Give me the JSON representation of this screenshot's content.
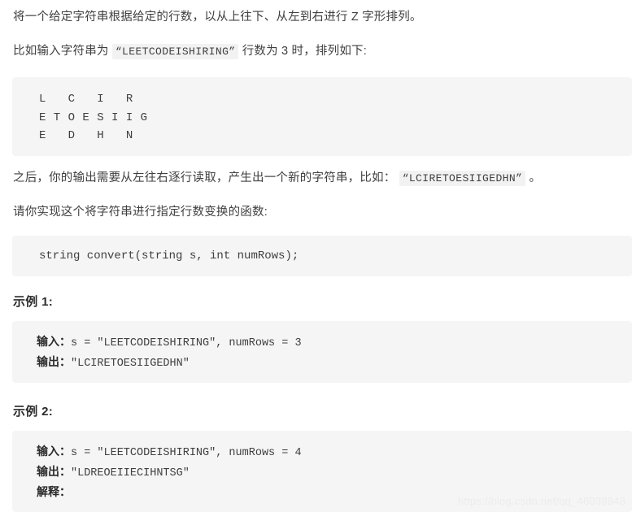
{
  "document": {
    "paragraphs": {
      "intro": "将一个给定字符串根据给定的行数，以从上往下、从左到右进行 Z 字形排列。",
      "example_lead_before": "比如输入字符串为",
      "example_lead_code": "“LEETCODEISHIRING”",
      "example_lead_after": "行数为 3 时，排列如下:",
      "read_lead_before": "之后，你的输出需要从左往右逐行读取，产生出一个新的字符串，比如：",
      "read_lead_code": "“LCIRETOESIIGEDHN”",
      "read_lead_after": "。",
      "implement": "请你实现这个将字符串进行指定行数变换的函数:"
    },
    "zigzag_diagram": {
      "rows": [
        "L   C   I   R",
        "E T O E S I I G",
        "E   D   H   N"
      ]
    },
    "signature": {
      "code": "string convert(string s, int numRows);"
    },
    "examples": [
      {
        "heading": "示例 1:",
        "input_label": "输入：",
        "input_value": "s = \"LEETCODEISHIRING\", numRows = 3",
        "output_label": "输出：",
        "output_value": "\"LCIRETOESIIGEDHN\""
      },
      {
        "heading": "示例 2:",
        "input_label": "输入：",
        "input_value": "s = \"LEETCODEISHIRING\", numRows = 4",
        "output_label": "输出：",
        "output_value": "\"LDREOEIIECIHNTSG\"",
        "explain_label": "解释："
      }
    ],
    "watermark": "https://blog.csdn.net/qq_46039848",
    "colors": {
      "page_background": "#ffffff",
      "code_background": "#f5f5f5",
      "inline_code_background": "#f2f2f2",
      "body_text": "#3f3f3f",
      "heading_text": "#2b2b2b",
      "watermark_text": "#ececec"
    }
  }
}
